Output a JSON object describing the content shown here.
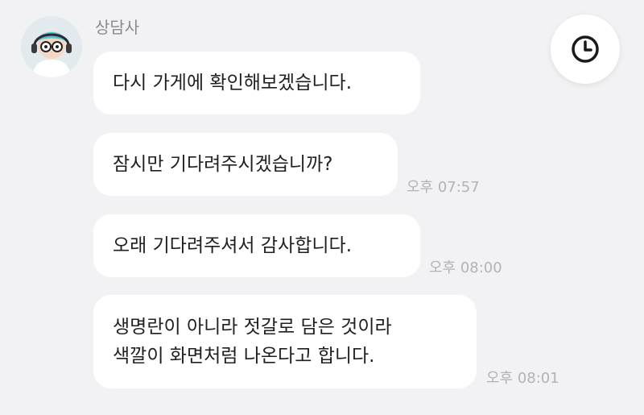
{
  "chat": {
    "sender_name": "상담사",
    "messages": [
      {
        "text": "다시 가게에 확인해보겠습니다.",
        "time": ""
      },
      {
        "text": "잠시만 기다려주시겠습니까?",
        "time": "오후 07:57"
      },
      {
        "text": "오래 기다려주셔서 감사합니다.",
        "time": "오후 08:00"
      },
      {
        "lines": [
          "생명란이 아니라 젓갈로 담은 것이라",
          "색깔이 화면처럼 나온다고 합니다."
        ],
        "time": "오후 08:01"
      }
    ]
  },
  "icons": {
    "avatar": "agent-avatar-icon",
    "history": "clock-icon"
  },
  "colors": {
    "background": "#f2f2f4",
    "bubble": "#ffffff",
    "timestamp": "#b3b3b7",
    "sender": "#8a8a8e"
  }
}
